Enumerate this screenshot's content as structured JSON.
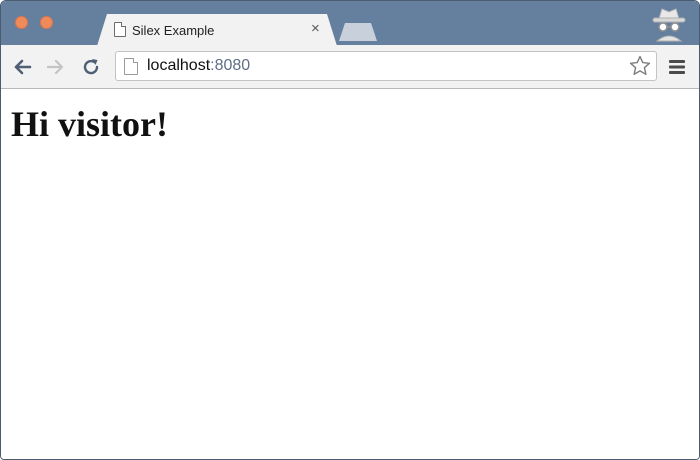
{
  "colors": {
    "titlebar": "#65809f",
    "tab_active": "#f2f2f2",
    "traffic_light": "#ef8a5b",
    "url_port": "#5f6f86"
  },
  "icons": [
    "close-window-icon",
    "minimize-window-icon",
    "document-icon",
    "close-tab-icon",
    "incognito-icon",
    "back-arrow-icon",
    "forward-arrow-icon",
    "reload-icon",
    "page-icon",
    "bookmark-star-icon",
    "menu-icon"
  ],
  "tab": {
    "title": "Silex Example",
    "close_glyph": "×"
  },
  "address_bar": {
    "host": "localhost",
    "port": ":8080"
  },
  "page": {
    "heading": "Hi visitor!"
  }
}
